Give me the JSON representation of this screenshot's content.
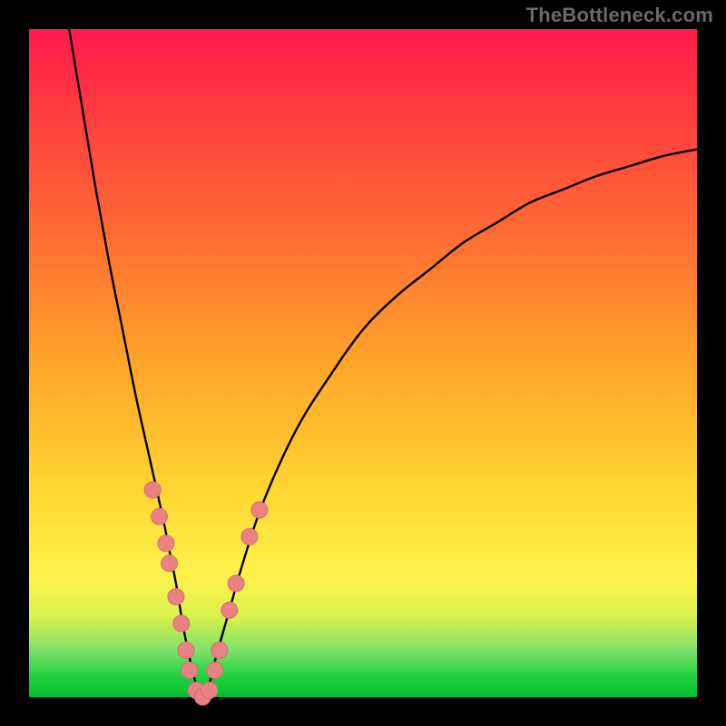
{
  "watermark": "TheBottleneck.com",
  "colors": {
    "frame": "#000000",
    "curve": "#000000",
    "dot_fill": "#e98383",
    "dot_stroke": "#d76f6f",
    "gradient_top": "#ff1a4d",
    "gradient_bottom": "#00c030"
  },
  "chart_data": {
    "type": "line",
    "title": "",
    "xlabel": "",
    "ylabel": "",
    "xlim": [
      0,
      100
    ],
    "ylim": [
      0,
      100
    ],
    "grid": false,
    "legend": false,
    "note": "V-shaped bottleneck curve; y=mismatch %, x=relative component score. No axis labels or tick values are shown in the source image; numeric values are estimates read from pixel position.",
    "series": [
      {
        "name": "bottleneck-curve",
        "x": [
          6,
          8,
          10,
          12,
          14,
          16,
          18,
          20,
          21,
          22,
          23,
          24,
          25,
          26,
          27,
          28,
          30,
          32,
          35,
          40,
          45,
          50,
          55,
          60,
          65,
          70,
          75,
          80,
          85,
          90,
          95,
          100
        ],
        "y": [
          100,
          88,
          76,
          65,
          55,
          45,
          36,
          27,
          22,
          17,
          11,
          6,
          2,
          0,
          2,
          6,
          13,
          20,
          29,
          40,
          48,
          55,
          60,
          64,
          68,
          71,
          74,
          76,
          78,
          79.5,
          81,
          82
        ]
      }
    ],
    "points": [
      {
        "name": "left-dot-1",
        "x": 18.5,
        "y": 31
      },
      {
        "name": "left-dot-2",
        "x": 19.5,
        "y": 27
      },
      {
        "name": "left-dot-3",
        "x": 20.5,
        "y": 23
      },
      {
        "name": "left-dot-4",
        "x": 21.0,
        "y": 20
      },
      {
        "name": "left-dot-5",
        "x": 22.0,
        "y": 15
      },
      {
        "name": "left-dot-6",
        "x": 22.8,
        "y": 11
      },
      {
        "name": "left-dot-7",
        "x": 23.5,
        "y": 7
      },
      {
        "name": "left-dot-8",
        "x": 24.0,
        "y": 4
      },
      {
        "name": "bottom-dot-1",
        "x": 25.0,
        "y": 1
      },
      {
        "name": "bottom-dot-2",
        "x": 26.0,
        "y": 0
      },
      {
        "name": "bottom-dot-3",
        "x": 27.0,
        "y": 1
      },
      {
        "name": "right-dot-1",
        "x": 27.8,
        "y": 4
      },
      {
        "name": "right-dot-2",
        "x": 28.5,
        "y": 7
      },
      {
        "name": "right-dot-3",
        "x": 30.0,
        "y": 13
      },
      {
        "name": "right-dot-4",
        "x": 31.0,
        "y": 17
      },
      {
        "name": "right-dot-5",
        "x": 33.0,
        "y": 24
      },
      {
        "name": "right-dot-6",
        "x": 34.5,
        "y": 28
      }
    ]
  }
}
